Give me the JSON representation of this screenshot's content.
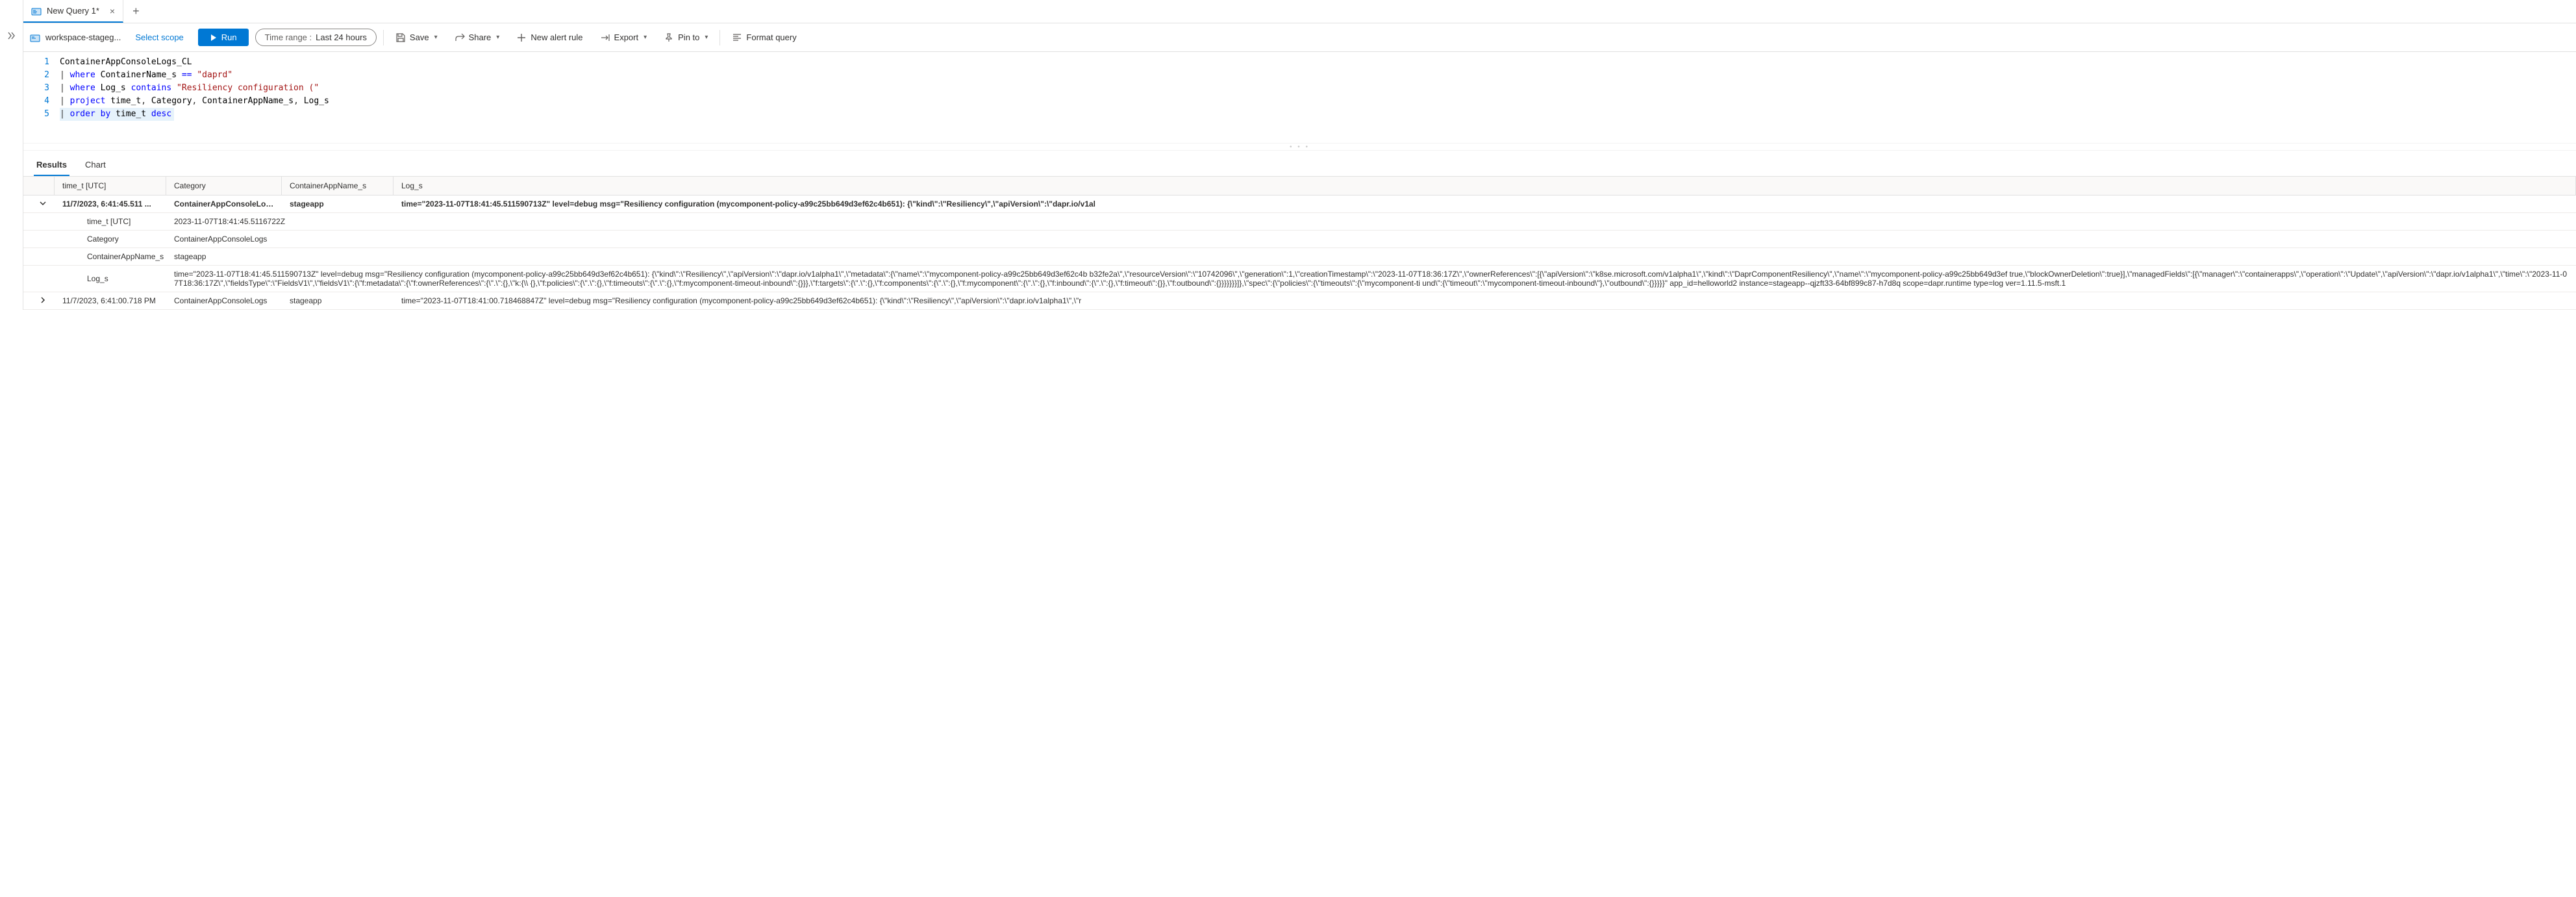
{
  "tabs": {
    "items": [
      {
        "title": "New Query 1*",
        "active": true
      }
    ]
  },
  "toolbar": {
    "workspace": "workspace-stageg...",
    "select_scope": "Select scope",
    "run": "Run",
    "time_range_label": "Time range :",
    "time_range_value": "Last 24 hours",
    "save": "Save",
    "share": "Share",
    "new_alert": "New alert rule",
    "export": "Export",
    "pin_to": "Pin to",
    "format_query": "Format query"
  },
  "editor": {
    "lines": [
      {
        "num": "1",
        "tokens": [
          [
            "id",
            "ContainerAppConsoleLogs_CL"
          ]
        ]
      },
      {
        "num": "2",
        "tokens": [
          [
            "punc",
            "| "
          ],
          [
            "kw",
            "where"
          ],
          [
            "id",
            " ContainerName_s "
          ],
          [
            "op",
            "=="
          ],
          [
            "id",
            " "
          ],
          [
            "str",
            "\"daprd\""
          ]
        ]
      },
      {
        "num": "3",
        "tokens": [
          [
            "punc",
            "| "
          ],
          [
            "kw",
            "where"
          ],
          [
            "id",
            " Log_s "
          ],
          [
            "kw",
            "contains"
          ],
          [
            "id",
            " "
          ],
          [
            "str",
            "\"Resiliency configuration (\""
          ]
        ]
      },
      {
        "num": "4",
        "tokens": [
          [
            "punc",
            "| "
          ],
          [
            "kw",
            "project"
          ],
          [
            "id",
            " time_t"
          ],
          [
            "punc",
            ","
          ],
          [
            "id",
            " Category"
          ],
          [
            "punc",
            ","
          ],
          [
            "id",
            " ContainerAppName_s"
          ],
          [
            "punc",
            ","
          ],
          [
            "id",
            " Log_s"
          ]
        ]
      },
      {
        "num": "5",
        "tokens": [
          [
            "punc",
            "| "
          ],
          [
            "kw",
            "order by"
          ],
          [
            "id",
            " time_t "
          ],
          [
            "kw",
            "desc"
          ]
        ],
        "selected": true
      }
    ]
  },
  "results": {
    "tabs": {
      "results": "Results",
      "chart": "Chart"
    },
    "columns": [
      "time_t [UTC]",
      "Category",
      "ContainerAppName_s",
      "Log_s"
    ],
    "rows": [
      {
        "expanded": true,
        "time": "11/7/2023, 6:41:45.511 ...",
        "category": "ContainerAppConsoleLogs",
        "app": "stageapp",
        "log": "time=\"2023-11-07T18:41:45.511590713Z\" level=debug msg=\"Resiliency configuration (mycomponent-policy-a99c25bb649d3ef62c4b651): {\\\"kind\\\":\\\"Resiliency\\\",\\\"apiVersion\\\":\\\"dapr.io/v1al",
        "details": [
          {
            "key": "time_t [UTC]",
            "val": "2023-11-07T18:41:45.5116722Z"
          },
          {
            "key": "Category",
            "val": "ContainerAppConsoleLogs"
          },
          {
            "key": "ContainerAppName_s",
            "val": "stageapp"
          },
          {
            "key": "Log_s",
            "val": "time=\"2023-11-07T18:41:45.511590713Z\" level=debug msg=\"Resiliency configuration (mycomponent-policy-a99c25bb649d3ef62c4b651): {\\\"kind\\\":\\\"Resiliency\\\",\\\"apiVersion\\\":\\\"dapr.io/v1alpha1\\\",\\\"metadata\\\":{\\\"name\\\":\\\"mycomponent-policy-a99c25bb649d3ef62c4b b32fe2a\\\",\\\"resourceVersion\\\":\\\"10742096\\\",\\\"generation\\\":1,\\\"creationTimestamp\\\":\\\"2023-11-07T18:36:17Z\\\",\\\"ownerReferences\\\":[{\\\"apiVersion\\\":\\\"k8se.microsoft.com/v1alpha1\\\",\\\"kind\\\":\\\"DaprComponentResiliency\\\",\\\"name\\\":\\\"mycomponent-policy-a99c25bb649d3ef true,\\\"blockOwnerDeletion\\\":true}],\\\"managedFields\\\":[{\\\"manager\\\":\\\"containerapps\\\",\\\"operation\\\":\\\"Update\\\",\\\"apiVersion\\\":\\\"dapr.io/v1alpha1\\\",\\\"time\\\":\\\"2023-11-07T18:36:17Z\\\",\\\"fieldsType\\\":\\\"FieldsV1\\\",\\\"fieldsV1\\\":{\\\"f:metadata\\\":{\\\"f:ownerReferences\\\":{\\\".\\\":{},\\\"k:{\\\\ {},\\\"f:policies\\\":{\\\".\\\":{},\\\"f:timeouts\\\":{\\\".\\\":{},\\\"f:mycomponent-timeout-inbound\\\":{}}},\\\"f:targets\\\":{\\\".\\\":{},\\\"f:components\\\":{\\\".\\\":{},\\\"f:mycomponent\\\":{\\\".\\\":{},\\\"f:inbound\\\":{\\\".\\\":{},\\\"f:timeout\\\":{}},\\\"f:outbound\\\":{}}}}}}}]},\\\"spec\\\":{\\\"policies\\\":{\\\"timeouts\\\":{\\\"mycomponent-ti und\\\":{\\\"timeout\\\":\\\"mycomponent-timeout-inbound\\\"},\\\"outbound\\\":{}}}}}\" app_id=helloworld2 instance=stageapp--qjzft33-64bf899c87-h7d8q scope=dapr.runtime type=log ver=1.11.5-msft.1"
          }
        ]
      },
      {
        "expanded": false,
        "time": "11/7/2023, 6:41:00.718 PM",
        "category": "ContainerAppConsoleLogs",
        "app": "stageapp",
        "log": "time=\"2023-11-07T18:41:00.718468847Z\" level=debug msg=\"Resiliency configuration (mycomponent-policy-a99c25bb649d3ef62c4b651): {\\\"kind\\\":\\\"Resiliency\\\",\\\"apiVersion\\\":\\\"dapr.io/v1alpha1\\\",\\\"r"
      }
    ]
  }
}
